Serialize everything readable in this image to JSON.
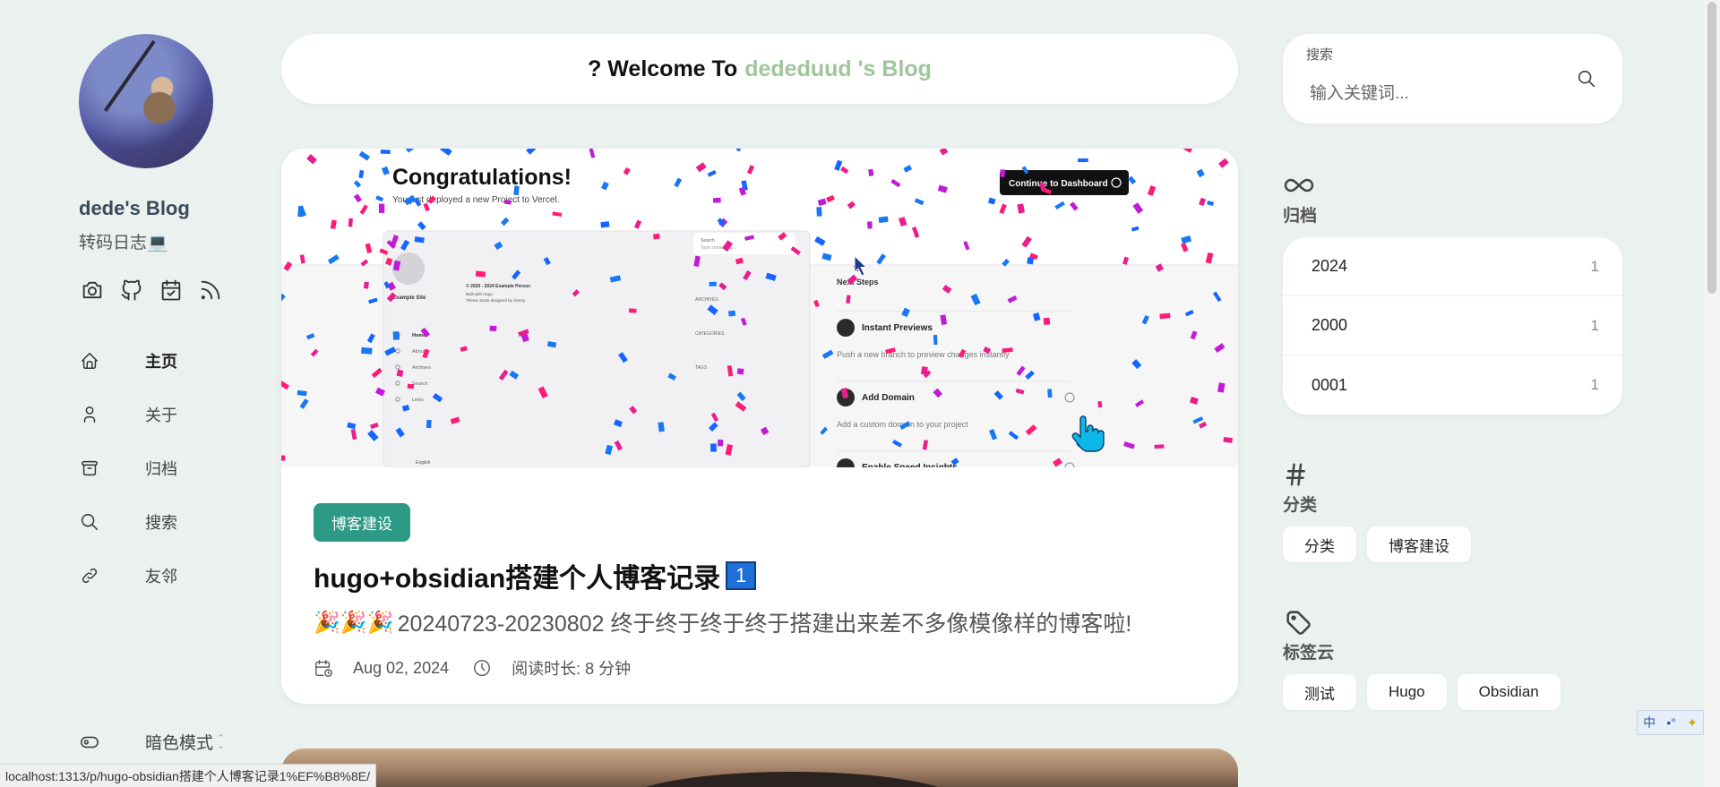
{
  "sidebar": {
    "blog_name": "dede's Blog",
    "subtitle": "转码日志💻",
    "social_icons": [
      "camera-icon",
      "github-icon",
      "calendar-icon",
      "rss-icon"
    ],
    "nav": [
      {
        "label": "主页",
        "icon": "home-icon",
        "active": true
      },
      {
        "label": "关于",
        "icon": "user-icon",
        "active": false
      },
      {
        "label": "归档",
        "icon": "archive-icon",
        "active": false
      },
      {
        "label": "搜索",
        "icon": "search-icon",
        "active": false
      },
      {
        "label": "友邻",
        "icon": "link-icon",
        "active": false
      }
    ],
    "dark_mode_label": "暗色模式"
  },
  "main": {
    "welcome_prefix": "? Welcome To",
    "welcome_accent": "dededuud 's Blog",
    "post": {
      "category": "博客建设",
      "title": "hugo+obsidian搭建个人博客记录",
      "title_keycap": "1",
      "description_emoji": "🎉🎉🎉",
      "description": "20240723-20230802 终于终于终于终于搭建出来差不多像模像样的博客啦!",
      "date": "Aug 02, 2024",
      "read_time": "阅读时长: 8 分钟",
      "image": {
        "heading": "Congratulations!",
        "subheading": "You just deployed a new Project to Vercel.",
        "dashboard_button": "Continue to Dashboard",
        "next_steps_title": "Next Steps",
        "steps": [
          {
            "title": "Instant Previews",
            "desc": "Push a new branch to preview changes instantly"
          },
          {
            "title": "Add Domain",
            "desc": "Add a custom domain to your project"
          },
          {
            "title": "Enable Speed Insights",
            "desc": ""
          }
        ],
        "mini_site": {
          "site_title": "Example Site",
          "search_label": "Search",
          "search_placeholder": "Type something...",
          "copyright": "© 2020 - 2024 Example Person",
          "built_with": "Built with Hugo",
          "theme": "Theme Stack designed by Jimmy",
          "menu": [
            "Home",
            "About",
            "Archives",
            "Search",
            "Links"
          ],
          "widgets": [
            "ARCHIVES",
            "CATEGORIES",
            "TAGS"
          ],
          "language": "English"
        }
      }
    }
  },
  "right": {
    "search": {
      "label": "搜索",
      "placeholder": "输入关键词..."
    },
    "archives": {
      "title": "归档",
      "items": [
        {
          "year": "2024",
          "count": "1"
        },
        {
          "year": "2000",
          "count": "1"
        },
        {
          "year": "0001",
          "count": "1"
        }
      ]
    },
    "categories": {
      "title": "分类",
      "items": [
        "分类",
        "博客建设"
      ]
    },
    "tags": {
      "title": "标签云",
      "items": [
        "测试",
        "Hugo",
        "Obsidian"
      ]
    }
  },
  "status_bar": {
    "url": "localhost:1313/p/hugo-obsidian搭建个人博客记录1%EF%B8%8E/"
  },
  "ime": {
    "label": "中"
  },
  "colors": {
    "accent_green": "#9fc69b",
    "category_chip": "#2c9a86",
    "background": "#eaf1ee"
  }
}
